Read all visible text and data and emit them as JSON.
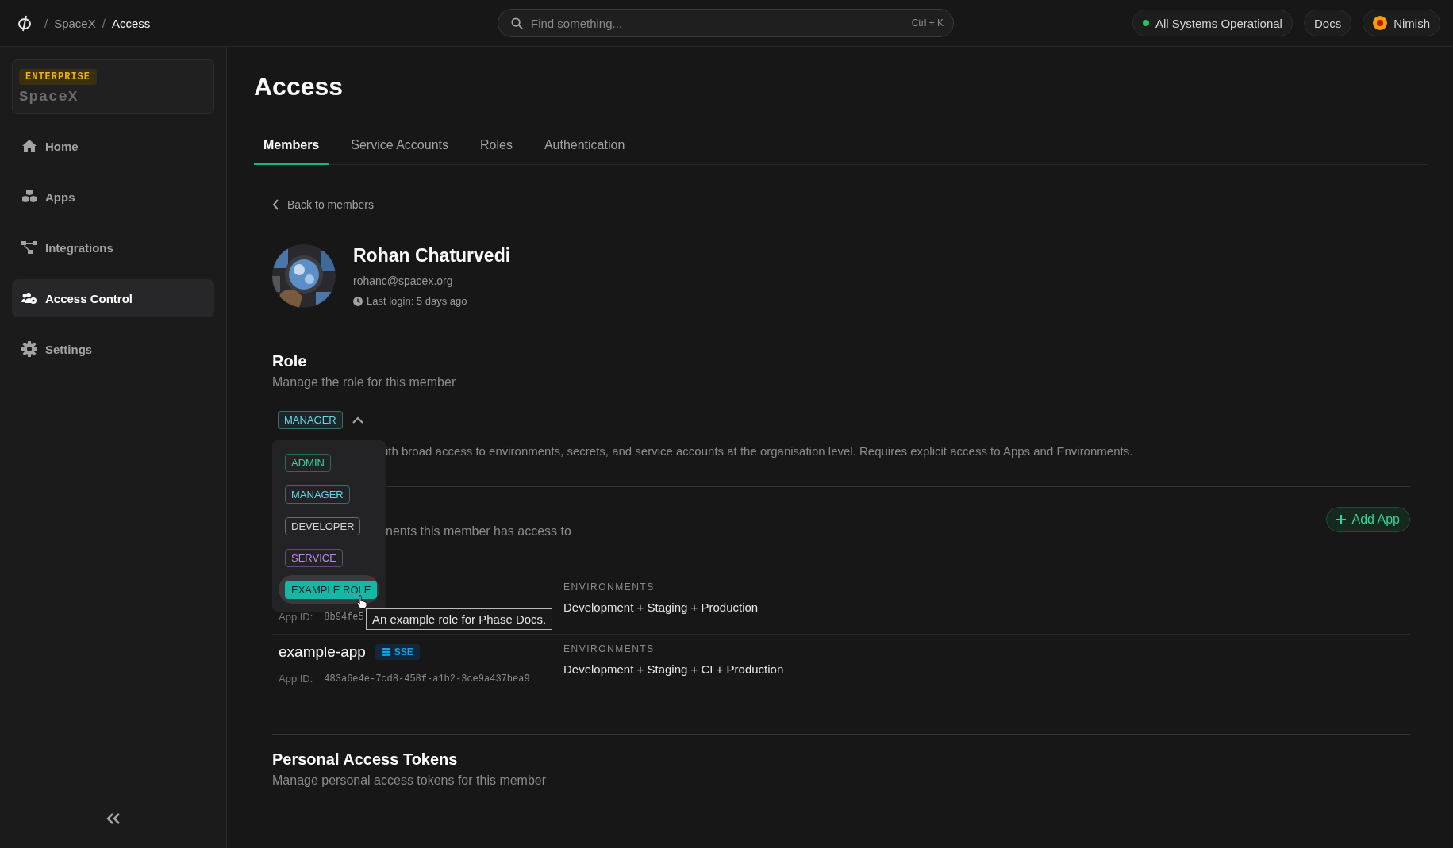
{
  "topbar": {
    "breadcrumbs": [
      {
        "separator": "/",
        "label": "SpaceX",
        "current": false
      },
      {
        "separator": "/",
        "label": "Access",
        "current": true
      }
    ],
    "search": {
      "placeholder": "Find something...",
      "shortcut": "Ctrl + K"
    },
    "status": {
      "label": "All Systems Operational",
      "color": "#22c55e"
    },
    "docs": "Docs",
    "user": "Nimish"
  },
  "sidebar": {
    "org": {
      "plan": "ENTERPRISE",
      "name": "SpaceX"
    },
    "items": [
      {
        "label": "Home",
        "kind": "home",
        "selected": false
      },
      {
        "label": "Apps",
        "kind": "apps",
        "selected": false
      },
      {
        "label": "Integrations",
        "kind": "integrations",
        "selected": false
      },
      {
        "label": "Access Control",
        "kind": "access",
        "selected": true
      },
      {
        "label": "Settings",
        "kind": "settings",
        "selected": false
      }
    ]
  },
  "page": {
    "title": "Access",
    "tabs": [
      {
        "label": "Members",
        "selected": true
      },
      {
        "label": "Service Accounts",
        "selected": false
      },
      {
        "label": "Roles",
        "selected": false
      },
      {
        "label": "Authentication",
        "selected": false
      }
    ]
  },
  "member": {
    "back": "Back to members",
    "name": "Rohan Chaturvedi",
    "email": "rohanc@spacex.org",
    "last_login": "Last login: 5 days ago"
  },
  "role": {
    "title": "Role",
    "subtitle": "Manage the role for this member",
    "current": {
      "label": "MANAGER",
      "color": "#67d4e8"
    },
    "expanded": true,
    "description": "ith broad access to environments, secrets, and service accounts at the organisation level. Requires explicit access to Apps and Environments.",
    "options": [
      {
        "label": "ADMIN",
        "color": "#34d399",
        "hovered": false
      },
      {
        "label": "MANAGER",
        "color": "#67d4e8",
        "hovered": false
      },
      {
        "label": "DEVELOPER",
        "color": "#d4d4d4",
        "hovered": false
      },
      {
        "label": "SERVICE",
        "color": "#c084fc",
        "hovered": false
      },
      {
        "label": "EXAMPLE ROLE",
        "color": "#14b8a6",
        "hovered": true
      }
    ],
    "tooltip": "An example role for Phase Docs."
  },
  "apps": {
    "subtitle": "nents this member has access to",
    "add_button": "Add App",
    "rows": [
      {
        "id_label": "App ID:",
        "app_id": "8b94fe5",
        "env_label": "ENVIRONMENTS",
        "environments": "Development + Staging + Production"
      },
      {
        "name": "example-app",
        "badge": "SSE",
        "id_label": "App ID:",
        "app_id": "483a6e4e-7cd8-458f-a1b2-3ce9a437bea9",
        "env_label": "ENVIRONMENTS",
        "environments": "Development + Staging + CI + Production"
      }
    ]
  },
  "tokens": {
    "title": "Personal Access Tokens",
    "subtitle": "Manage personal access tokens for this member"
  }
}
